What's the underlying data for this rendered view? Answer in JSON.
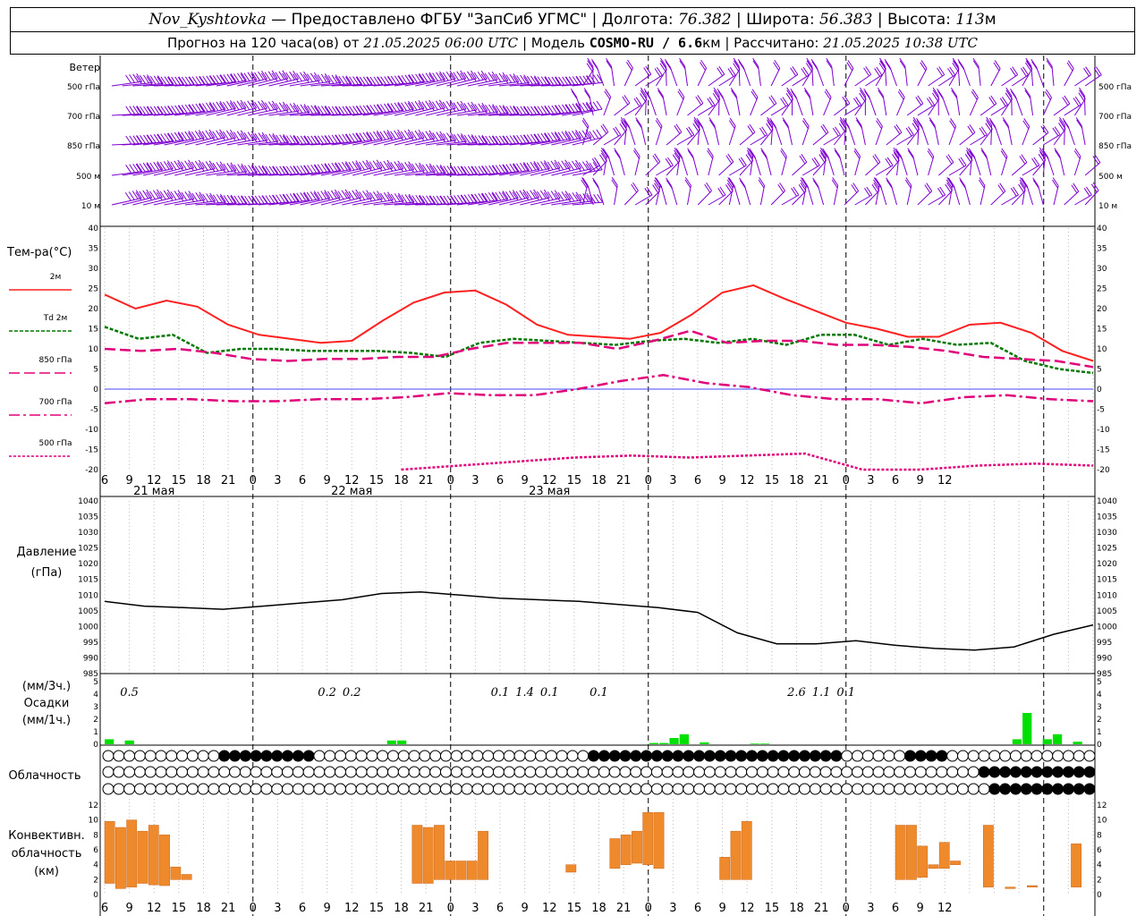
{
  "header": {
    "station": "Nov_Kyshtovka",
    "provider": "— Предоставлено ФГБУ \"ЗапСиб УГМС\"",
    "lon_label": "Долгота:",
    "lon": "76.382",
    "lat_label": "Широта:",
    "lat": "56.383",
    "alt_label": "Высота:",
    "alt": "113",
    "alt_unit": "м",
    "forecast_prefix": "Прогноз на 120 часа(ов) от",
    "forecast_from": "21.05.2025 06:00 UTC",
    "model_label": "Модель",
    "model": "COSMO-RU / 6.6",
    "model_unit": "км",
    "calc_label": "Рассчитано:",
    "calc_time": "21.05.2025 10:38 UTC"
  },
  "labels": {
    "wind": "Ветер",
    "wind_levels": [
      "500 гПа",
      "700 гПа",
      "850 гПа",
      "500 м",
      "10 м"
    ],
    "temp_title": "Тем-ра(°С)",
    "temp_series": [
      "2м",
      "Td 2м",
      "850 гПа",
      "700 гПа",
      "500 гПа"
    ],
    "pressure_title": "Давление",
    "pressure_unit": "(гПа)",
    "precip_unit3": "(мм/3ч.)",
    "precip_title": "Осадки",
    "precip_unit1": "(мм/1ч.)",
    "cloud_title": "Облачность",
    "conv_line1": "Конвективн.",
    "conv_line2": "облачность",
    "conv_line3": "(км)"
  },
  "colors": {
    "t2m": "#ff2020",
    "td2m": "#007800",
    "t850": "#e0007a",
    "t700": "#e0007a",
    "t500": "#e0007a",
    "wind": "#7d00d0",
    "precip": "#00e000",
    "conv": "#ef8a2c",
    "pressure": "#000000"
  },
  "chart_data": [
    {
      "type": "line",
      "name": "temperature",
      "x_hours": [
        0,
        3,
        6,
        9,
        12,
        15,
        18,
        21,
        24,
        27,
        30,
        33,
        36,
        39,
        42,
        45,
        48,
        51,
        54,
        57,
        60,
        63,
        66,
        69,
        72,
        75,
        78,
        81,
        84,
        87,
        90,
        93,
        96,
        99,
        102,
        105,
        108,
        111,
        114,
        117,
        120
      ],
      "x_tick_labels": [
        "6",
        "9",
        "12",
        "15",
        "18",
        "21",
        "0",
        "3",
        "6",
        "9",
        "12",
        "15",
        "18",
        "21",
        "0",
        "3",
        "6",
        "9",
        "12",
        "15",
        "18",
        "21",
        "0",
        "3",
        "6",
        "9",
        "12",
        "15",
        "18",
        "21",
        "0",
        "3",
        "6",
        "9",
        "12"
      ],
      "date_labels": [
        "21 мая",
        "22 мая",
        "23 мая"
      ],
      "ylim": [
        -20,
        40
      ],
      "y_ticks": [
        40,
        35,
        30,
        25,
        20,
        15,
        10,
        5,
        0,
        -5,
        -10,
        -15,
        -20
      ],
      "series": [
        {
          "name": "2м",
          "values": [
            23.5,
            20,
            22,
            20.5,
            16,
            13.5,
            12.5,
            11.5,
            12,
            17,
            21.5,
            24,
            24.5,
            21,
            16,
            13.5,
            13,
            12.5,
            14,
            18.5,
            24,
            25.8,
            22.5,
            19.5,
            16.5,
            15,
            13,
            13,
            16,
            16.5,
            14,
            9.5,
            7
          ]
        },
        {
          "name": "Td 2м",
          "values": [
            15.5,
            12.5,
            13.5,
            9,
            10,
            10,
            9.5,
            9.5,
            9.5,
            9,
            8,
            11.5,
            12.5,
            12,
            11.5,
            11,
            12,
            12.5,
            11.5,
            12.5,
            11,
            13.5,
            13.5,
            11,
            12.5,
            11,
            11.5,
            7,
            5,
            4
          ]
        },
        {
          "name": "850 гПа",
          "values": [
            10,
            9.5,
            10,
            9,
            7.5,
            7,
            7.5,
            7.5,
            8,
            8,
            10,
            11.5,
            11.5,
            11.5,
            10,
            12,
            14.5,
            11.5,
            12,
            12,
            11,
            11,
            10.5,
            9.5,
            8,
            7.5,
            7,
            5.5
          ]
        },
        {
          "name": "700 гПа",
          "values": [
            -3.5,
            -2.5,
            -2.5,
            -3,
            -3,
            -2.5,
            -2.5,
            -2,
            -1,
            -1.5,
            -1.5,
            0,
            2,
            3.5,
            1.5,
            0.5,
            -1.5,
            -2.5,
            -2.5,
            -3.5,
            -2,
            -1.5,
            -2.5,
            -3
          ]
        },
        {
          "name": "500 гПа",
          "values": [
            -20,
            -19,
            -18,
            -17,
            -16.5,
            -17,
            -16.5,
            -16,
            -20,
            -20,
            -19,
            -18.5,
            -19
          ]
        }
      ]
    },
    {
      "type": "line",
      "name": "pressure",
      "ylim": [
        985,
        1040
      ],
      "y_ticks": [
        1040,
        1035,
        1030,
        1025,
        1020,
        1015,
        1010,
        1005,
        1000,
        995,
        990,
        985
      ],
      "series": [
        {
          "name": "Давление",
          "values": [
            1008,
            1006.5,
            1006,
            1005.5,
            1006.5,
            1007.5,
            1008.5,
            1010.5,
            1011,
            1010,
            1009,
            1008.5,
            1008,
            1007,
            1006,
            1004.5,
            998,
            994.5,
            994.5,
            995.5,
            994,
            993,
            992.5,
            993.5,
            997.5,
            1000.5
          ]
        }
      ]
    },
    {
      "type": "bar",
      "name": "precipitation",
      "ylim": [
        0,
        5
      ],
      "labels_3h": [
        "0.5",
        "0.2",
        "0.2",
        "0.1",
        "1.4",
        "0.1",
        "0.1",
        "2.6",
        "1.1",
        "0.1"
      ],
      "values_hourly": [
        0.4,
        0,
        0.3,
        0,
        0,
        0,
        0,
        0,
        0,
        0,
        0,
        0,
        0,
        0,
        0,
        0,
        0,
        0,
        0,
        0,
        0,
        0,
        0,
        0,
        0,
        0,
        0,
        0,
        0.3,
        0.3,
        0,
        0,
        0,
        0,
        0,
        0,
        0,
        0,
        0,
        0,
        0,
        0,
        0,
        0,
        0,
        0,
        0,
        0,
        0,
        0,
        0,
        0,
        0,
        0,
        0.1,
        0.1,
        0.5,
        0.8,
        0,
        0.15,
        0,
        0,
        0,
        0,
        0.05,
        0.05,
        0,
        0,
        0,
        0,
        0,
        0,
        0,
        0,
        0,
        0,
        0,
        0,
        0,
        0,
        0,
        0,
        0,
        0,
        0,
        0,
        0,
        0,
        0,
        0,
        0.4,
        2.5,
        0,
        0.4,
        0.8,
        0,
        0.2,
        0
      ]
    },
    {
      "type": "bar",
      "name": "convective_clouds",
      "ylim": [
        0,
        12
      ],
      "segments": [
        [
          1.5,
          9.8
        ],
        [
          0.8,
          9
        ],
        [
          1,
          10
        ],
        [
          1.5,
          8.5
        ],
        [
          1.3,
          9.3
        ],
        [
          1.2,
          8
        ],
        [
          2,
          3.7
        ],
        [
          2,
          2.7
        ],
        [
          1.5,
          9.3
        ],
        [
          1.5,
          9
        ],
        [
          2,
          9.3
        ],
        [
          2,
          4.5
        ],
        [
          2,
          4.5
        ],
        [
          2,
          4.5
        ],
        [
          2,
          8.5
        ],
        [
          3,
          4
        ],
        [
          3.5,
          7.5
        ],
        [
          4,
          8
        ],
        [
          4.2,
          8.5
        ],
        [
          4,
          11
        ],
        [
          3.5,
          11
        ],
        [
          2,
          5
        ],
        [
          2,
          8.5
        ],
        [
          2,
          9.8
        ],
        [
          2,
          9.3
        ],
        [
          2,
          9.3
        ],
        [
          2.3,
          6.5
        ],
        [
          3.5,
          4
        ],
        [
          3.5,
          7
        ],
        [
          4,
          4.5
        ],
        [
          1,
          9.3
        ],
        [
          0.8,
          1
        ],
        [
          1,
          1.2
        ],
        [
          1,
          6.8
        ]
      ]
    }
  ]
}
